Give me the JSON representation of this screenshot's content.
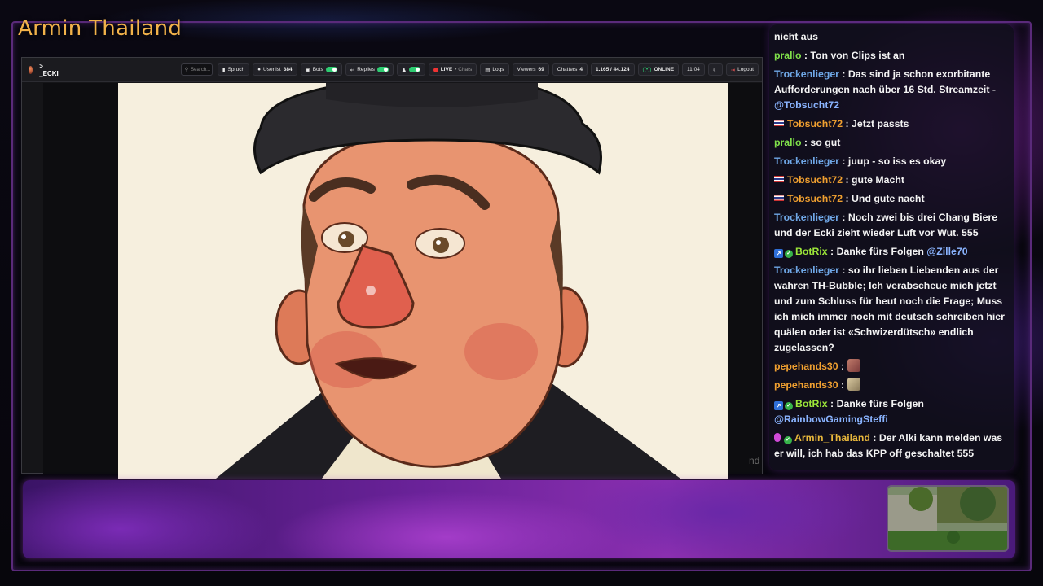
{
  "channel_title": "Armin Thailand",
  "dashboard": {
    "brand": "_ECKI",
    "search_placeholder": "Search...",
    "buttons": {
      "spruch": "Spruch",
      "userlist": "Userlist",
      "userlist_count": "384",
      "bots": "Bots",
      "replies": "Replies",
      "live": "LIVE",
      "chats": "Chats",
      "logs": "Logs",
      "viewers_label": "Viewers",
      "viewers_count": "69",
      "chatters_label": "Chatters",
      "chatters_count": "4",
      "ratio": "1.165 / 44.124",
      "online": "ONLINE",
      "time": "11:04",
      "logout": "Logout"
    },
    "video_edge_text": "nd"
  },
  "chat": {
    "messages": [
      {
        "user": "",
        "text": "nicht aus",
        "color": "blue"
      },
      {
        "user": "prallo",
        "text": "Ton von Clips ist an",
        "color": "green"
      },
      {
        "user": "Trockenlieger",
        "text": "Das sind ja schon exorbitante Aufforderungen nach über 16 Std. Streamzeit -",
        "mention": "@Tobsucht72",
        "color": "blue"
      },
      {
        "user": "Tobsucht72",
        "text": "Jetzt passts",
        "color": "orange",
        "flag": true
      },
      {
        "user": "prallo",
        "text": "so gut",
        "color": "green"
      },
      {
        "user": "Trockenlieger",
        "text": "juup - so iss es okay",
        "color": "blue"
      },
      {
        "user": "Tobsucht72",
        "text": "gute Macht",
        "color": "orange",
        "flag": true
      },
      {
        "user": "Tobsucht72",
        "text": "Und gute nacht",
        "color": "orange",
        "flag": true
      },
      {
        "user": "Trockenlieger",
        "text": "Noch zwei bis drei Chang Biere und der Ecki zieht wieder Luft vor Wut. 555",
        "color": "blue"
      },
      {
        "user": "BotRix",
        "text": "Danke fürs Folgen",
        "mention": "@Zille70",
        "color": "lime",
        "badges": true
      },
      {
        "user": "Trockenlieger",
        "text": "so ihr lieben Liebenden aus der wahren TH-Bubble; Ich verabscheue mich jetzt und zum Schluss für heut noch die Frage; Muss ich mich immer noch mit deutsch schreiben hier quälen oder ist «Schwizerdütsch» endlich zugelassen?",
        "color": "blue"
      },
      {
        "user": "pepehands30",
        "text": "",
        "color": "orange",
        "emote": "a"
      },
      {
        "user": "pepehands30",
        "text": "",
        "color": "orange",
        "emote": "b"
      },
      {
        "user": "BotRix",
        "text": "Danke fürs Folgen",
        "mention": "@RainbowGamingSteffi",
        "color": "lime",
        "badges": true
      },
      {
        "user": "Armin_Thailand",
        "text": "Der Alki kann melden was er will, ich hab das KPP off geschaltet 555",
        "color": "gold",
        "mic": true
      }
    ]
  },
  "colors": {
    "title": "#f2b24a",
    "accent_purple": "#8a2fb0",
    "user_blue": "#6fa7e6",
    "user_green": "#7fe04a",
    "user_orange": "#f0a030"
  },
  "icons": [
    "search-icon",
    "user-icon",
    "bot-icon",
    "reply-icon",
    "live-dot-icon",
    "logs-icon",
    "online-icon",
    "moon-icon",
    "logout-icon",
    "thai-flag-icon",
    "check-badge-icon",
    "mic-badge-icon"
  ]
}
